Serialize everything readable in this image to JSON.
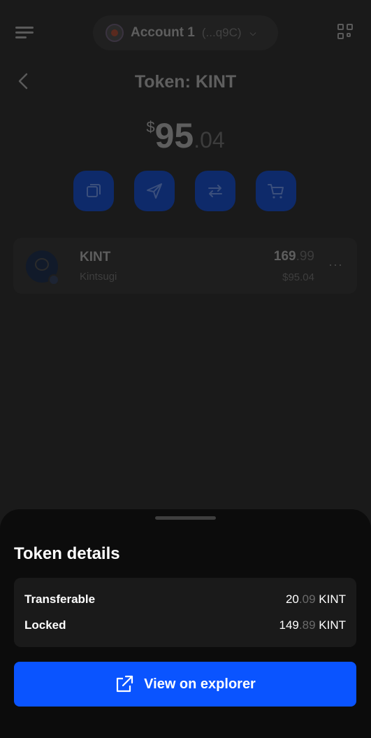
{
  "header": {
    "account_name": "Account 1",
    "account_address": "(...q9C)"
  },
  "page": {
    "title": "Token: KINT"
  },
  "balance": {
    "currency_symbol": "$",
    "integer": "95",
    "decimal": ".04"
  },
  "actions": [
    {
      "icon": "copy-icon"
    },
    {
      "icon": "send-icon"
    },
    {
      "icon": "swap-icon"
    },
    {
      "icon": "cart-icon"
    }
  ],
  "token": {
    "symbol": "KINT",
    "name": "Kintsugi",
    "amount_int": "169",
    "amount_dec": ".99",
    "fiat": "$95.04",
    "more": "···"
  },
  "sheet": {
    "title": "Token details",
    "rows": [
      {
        "label": "Transferable",
        "int": "20",
        "dec": ".09",
        "unit": "KINT"
      },
      {
        "label": "Locked",
        "int": "149",
        "dec": ".89",
        "unit": "KINT"
      }
    ],
    "explorer_button": "View on explorer"
  },
  "colors": {
    "accent": "#0a54ff",
    "background": "#1a1a1a",
    "sheet": "#0c0c0c"
  }
}
